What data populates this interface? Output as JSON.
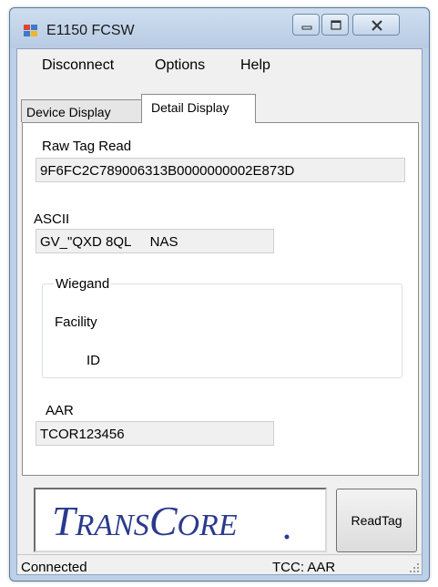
{
  "window": {
    "title": "E1150 FCSW",
    "icons": {
      "app": "app-icon",
      "minimize": "minimize-icon",
      "maximize": "maximize-icon",
      "close": "close-icon"
    }
  },
  "menu": {
    "items": [
      {
        "label": "Disconnect"
      },
      {
        "label": "Options"
      },
      {
        "label": "Help"
      }
    ]
  },
  "tabs": [
    {
      "label": "Device Display",
      "active": false
    },
    {
      "label": "Detail Display",
      "active": true
    }
  ],
  "detail": {
    "raw_tag_read": {
      "label": "Raw Tag Read",
      "value": "9F6FC2C789006313B0000000002E873D"
    },
    "ascii": {
      "label": "ASCII",
      "value": "GV_\"QXD 8QL     NAS"
    },
    "wiegand": {
      "title": "Wiegand",
      "facility_label": "Facility",
      "id_label": "ID"
    },
    "aar": {
      "label": "AAR",
      "value": "TCOR123456"
    }
  },
  "logo": {
    "text": "TRANSCORE",
    "name": "transcore-logo",
    "color": "#2b3a8c"
  },
  "buttons": {
    "read_tag": "ReadTag"
  },
  "status": {
    "left": "Connected",
    "right": "TCC: AAR"
  },
  "colors": {
    "window_frame": "#bcd0e7",
    "client_bg": "#f0f0f0",
    "panel_bg": "#ffffff",
    "field_bg": "#f0f0f0",
    "logo_blue": "#2b3a8c"
  }
}
